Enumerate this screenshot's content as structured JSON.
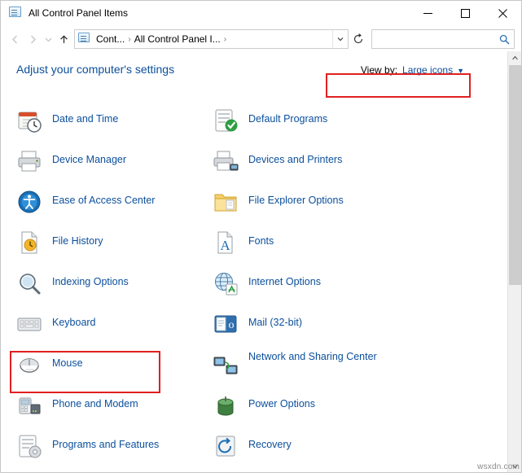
{
  "window": {
    "title": "All Control Panel Items",
    "title_icon": "control-panel-icon",
    "minimize": "minimize-icon",
    "maximize": "maximize-icon",
    "close": "close-icon"
  },
  "toolbar": {
    "back": "back-arrow-icon",
    "forward": "forward-arrow-icon",
    "recent": "chevron-down-icon",
    "up": "up-arrow-icon",
    "address_icon": "control-panel-icon",
    "breadcrumbs": [
      "Cont...",
      "All Control Panel I..."
    ],
    "breadcrumb_separator": "›",
    "address_dropdown": "chevron-down-icon",
    "refresh": "refresh-icon",
    "search_placeholder": "",
    "search_value": "",
    "search_icon": "search-icon"
  },
  "main": {
    "heading": "Adjust your computer's settings",
    "view_by": {
      "label": "View by:",
      "value": "Large icons",
      "caret": "chevron-down-icon"
    },
    "columns": [
      {
        "items": [
          {
            "label": "Date and Time",
            "icon": "calendar-clock-icon"
          },
          {
            "label": "Device Manager",
            "icon": "printer-device-icon"
          },
          {
            "label": "Ease of Access Center",
            "icon": "accessibility-icon"
          },
          {
            "label": "File History",
            "icon": "file-history-icon"
          },
          {
            "label": "Indexing Options",
            "icon": "magnifier-indexing-icon"
          },
          {
            "label": "Keyboard",
            "icon": "keyboard-icon"
          },
          {
            "label": "Mouse",
            "icon": "mouse-icon"
          },
          {
            "label": "Phone and Modem",
            "icon": "phone-modem-icon"
          },
          {
            "label": "Programs and Features",
            "icon": "programs-features-icon"
          }
        ]
      },
      {
        "items": [
          {
            "label": "Default Programs",
            "icon": "default-programs-icon"
          },
          {
            "label": "Devices and Printers",
            "icon": "devices-printers-icon"
          },
          {
            "label": "File Explorer Options",
            "icon": "folder-options-icon"
          },
          {
            "label": "Fonts",
            "icon": "fonts-icon"
          },
          {
            "label": "Internet Options",
            "icon": "internet-options-icon"
          },
          {
            "label": "Mail (32-bit)",
            "icon": "mail-icon"
          },
          {
            "label": "Network and Sharing Center",
            "icon": "network-sharing-icon"
          },
          {
            "label": "Power Options",
            "icon": "power-options-icon"
          },
          {
            "label": "Recovery",
            "icon": "recovery-icon"
          }
        ]
      }
    ],
    "highlights": [
      {
        "name": "view-by-highlight",
        "color": "#e02020"
      },
      {
        "name": "mouse-highlight",
        "color": "#e02020"
      }
    ]
  },
  "scrollbar": {
    "up_arrow": "chevron-up-icon",
    "down_arrow": "chevron-down-icon"
  },
  "watermark": "wsxdn.com"
}
